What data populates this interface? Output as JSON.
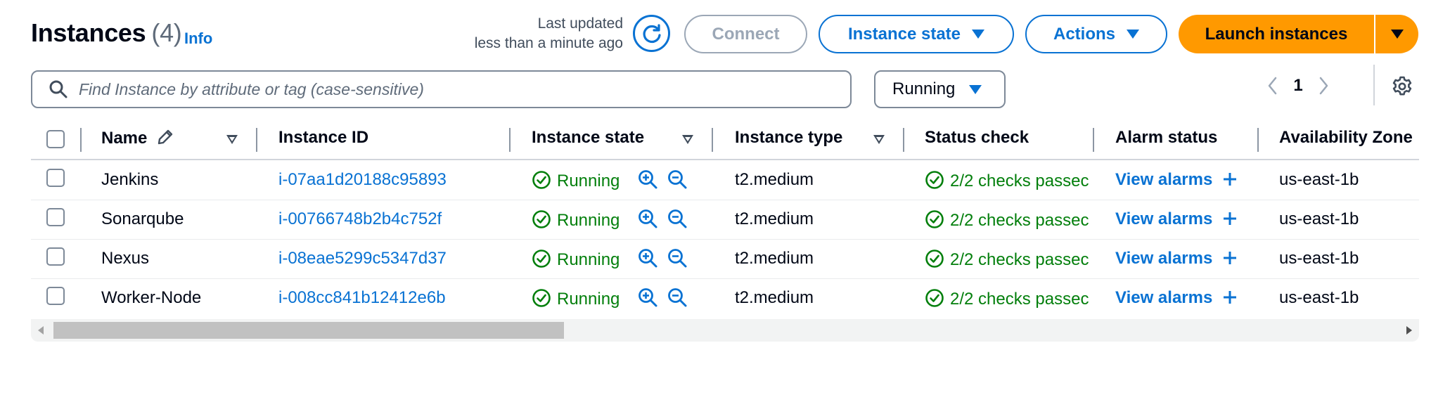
{
  "header": {
    "title": "Instances",
    "count": "(4)",
    "info_label": "Info",
    "last_updated_line1": "Last updated",
    "last_updated_line2": "less than a minute ago",
    "connect_label": "Connect",
    "instance_state_label": "Instance state",
    "actions_label": "Actions",
    "launch_label": "Launch instances"
  },
  "search": {
    "placeholder": "Find Instance by attribute or tag (case-sensitive)"
  },
  "filter": {
    "selected": "Running"
  },
  "pagination": {
    "current_page": "1"
  },
  "table": {
    "columns": {
      "name": "Name",
      "instance_id": "Instance ID",
      "instance_state": "Instance state",
      "instance_type": "Instance type",
      "status_check": "Status check",
      "alarm_status": "Alarm status",
      "availability_zone": "Availability Zone"
    },
    "rows": [
      {
        "name": "Jenkins",
        "instance_id": "i-07aa1d20188c95893",
        "state": "Running",
        "type": "t2.medium",
        "status_check": "2/2 checks passec",
        "alarm": "View alarms",
        "az": "us-east-1b"
      },
      {
        "name": "Sonarqube",
        "instance_id": "i-00766748b2b4c752f",
        "state": "Running",
        "type": "t2.medium",
        "status_check": "2/2 checks passec",
        "alarm": "View alarms",
        "az": "us-east-1b"
      },
      {
        "name": "Nexus",
        "instance_id": "i-08eae5299c5347d37",
        "state": "Running",
        "type": "t2.medium",
        "status_check": "2/2 checks passec",
        "alarm": "View alarms",
        "az": "us-east-1b"
      },
      {
        "name": "Worker-Node",
        "instance_id": "i-008cc841b12412e6b",
        "state": "Running",
        "type": "t2.medium",
        "status_check": "2/2 checks passec",
        "alarm": "View alarms",
        "az": "us-east-1b"
      }
    ]
  },
  "scrollbar": {
    "thumb_fraction": 0.38
  },
  "colors": {
    "link_blue": "#0972d3",
    "success_green": "#037f0c",
    "primary_orange": "#ff9900",
    "text_dark": "#000716"
  },
  "icons": {
    "refresh": "refresh-icon",
    "search": "search-icon",
    "settings": "gear-icon",
    "edit": "pencil-icon",
    "status_ok": "check-circle-icon",
    "zoom_in": "zoom-in-icon",
    "zoom_out": "zoom-out-icon",
    "add": "plus-icon"
  }
}
